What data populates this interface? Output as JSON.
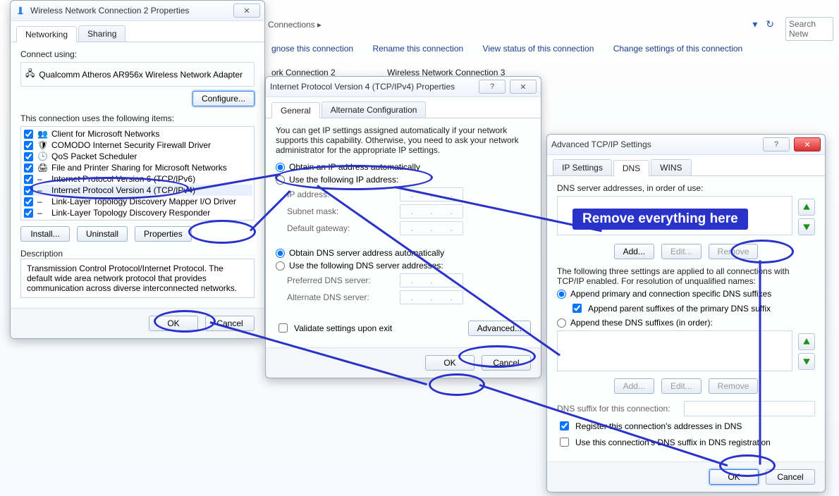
{
  "explorer": {
    "breadcrumb_tail": "Connections  ▸",
    "search_placeholder": "Search Netw",
    "commands": {
      "diagnose": "gnose this connection",
      "rename": "Rename this connection",
      "status": "View status of this connection",
      "change": "Change settings of this connection"
    },
    "conn_labels": {
      "a": "ork Connection 2",
      "b": "Wireless Network Connection 3"
    }
  },
  "win1": {
    "title": "Wireless Network Connection 2 Properties",
    "tabs": {
      "networking": "Networking",
      "sharing": "Sharing"
    },
    "connect_using": "Connect using:",
    "adapter": "Qualcomm Atheros AR956x Wireless Network Adapter",
    "configure": "Configure...",
    "items_label": "This connection uses the following items:",
    "items": [
      "Client for Microsoft Networks",
      "COMODO Internet Security Firewall Driver",
      "QoS Packet Scheduler",
      "File and Printer Sharing for Microsoft Networks",
      "Internet Protocol Version 6 (TCP/IPv6)",
      "Internet Protocol Version 4 (TCP/IPv4)",
      "Link-Layer Topology Discovery Mapper I/O Driver",
      "Link-Layer Topology Discovery Responder"
    ],
    "install": "Install...",
    "uninstall": "Uninstall",
    "properties": "Properties",
    "description_title": "Description",
    "description_text": "Transmission Control Protocol/Internet Protocol. The default wide area network protocol that provides communication across diverse interconnected networks.",
    "ok": "OK",
    "cancel": "Cancel"
  },
  "win2": {
    "title": "Internet Protocol Version 4 (TCP/IPv4) Properties",
    "tabs": {
      "general": "General",
      "alt": "Alternate Configuration"
    },
    "intro": "You can get IP settings assigned automatically if your network supports this capability. Otherwise, you need to ask your network administrator for the appropriate IP settings.",
    "r_obtain_ip": "Obtain an IP address automatically",
    "r_use_ip": "Use the following IP address:",
    "ip_address": "IP address:",
    "subnet_mask": "Subnet mask:",
    "gateway": "Default gateway:",
    "r_obtain_dns": "Obtain DNS server address automatically",
    "r_use_dns": "Use the following DNS server addresses:",
    "preferred_dns": "Preferred DNS server:",
    "alternate_dns": "Alternate DNS server:",
    "validate": "Validate settings upon exit",
    "advanced": "Advanced...",
    "ok": "OK",
    "cancel": "Cancel"
  },
  "win3": {
    "title": "Advanced TCP/IP Settings",
    "tabs": {
      "ip": "IP Settings",
      "dns": "DNS",
      "wins": "WINS"
    },
    "dns_order": "DNS server addresses, in order of use:",
    "add": "Add...",
    "edit": "Edit...",
    "remove": "Remove",
    "applied_text": "The following three settings are applied to all connections with TCP/IP enabled. For resolution of unqualified names:",
    "r_append_primary": "Append primary and connection specific DNS suffixes",
    "chk_parent": "Append parent suffixes of the primary DNS suffix",
    "r_append_these": "Append these DNS suffixes (in order):",
    "dns_suffix_label": "DNS suffix for this connection:",
    "chk_register": "Register this connection's addresses in DNS",
    "chk_use_suffix": "Use this connection's DNS suffix in DNS registration",
    "ok": "OK",
    "cancel": "Cancel"
  },
  "annot": {
    "banner": "Remove everything here"
  }
}
